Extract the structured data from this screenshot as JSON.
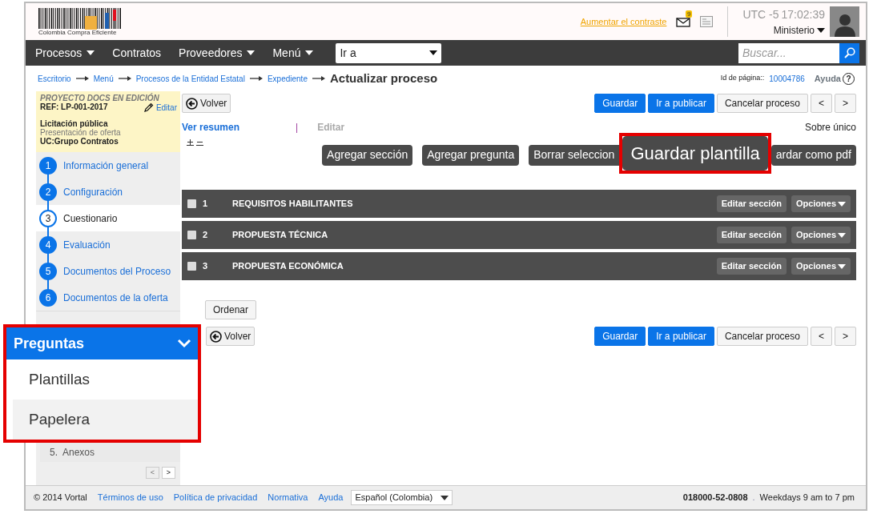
{
  "header": {
    "logo_text": "Colombia Compra Eficiente",
    "contrast_link": "Aumentar el contraste",
    "mail_count": "9",
    "timezone": "UTC -5",
    "time": "17:02:39",
    "user": "Ministerio"
  },
  "nav": {
    "items": [
      {
        "label": "Procesos",
        "dropdown": true
      },
      {
        "label": "Contratos",
        "dropdown": false
      },
      {
        "label": "Proveedores",
        "dropdown": true
      },
      {
        "label": "Menú",
        "dropdown": true
      }
    ],
    "goto": "Ir a",
    "search_placeholder": "Buscar..."
  },
  "breadcrumb": {
    "links": [
      "Escritorio",
      "Menú",
      "Procesos de la Entidad Estatal",
      "Expediente"
    ],
    "current": "Actualizar proceso",
    "page_id_label": "Id de página::",
    "page_id": "10004786",
    "help": "Ayuda",
    "help_mark": "?"
  },
  "sidebar": {
    "status": "PROYECTO DOCS EN EDICIÓN",
    "ref": "REF: LP-001-2017",
    "edit": "Editar",
    "type": "Licitación pública",
    "phase": "Presentación de oferta",
    "unit": "UC:Grupo Contratos",
    "steps": [
      {
        "number": "1",
        "label": "Información general",
        "selected": false
      },
      {
        "number": "2",
        "label": "Configuración",
        "selected": false
      },
      {
        "number": "3",
        "label": "Cuestionario",
        "selected": true
      },
      {
        "number": "4",
        "label": "Evaluación",
        "selected": false
      },
      {
        "number": "5",
        "label": "Documentos del Proceso",
        "selected": false
      },
      {
        "number": "6",
        "label": "Documentos de la oferta",
        "selected": false
      }
    ],
    "outline_number": "5.",
    "outline_item": "Anexos",
    "pager": [
      {
        "label": "<",
        "disabled": true
      },
      {
        "label": ">",
        "disabled": false
      }
    ]
  },
  "top_actions": {
    "back": "Volver",
    "buttons": [
      {
        "label": "Guardar",
        "kind": "primary"
      },
      {
        "label": "Ir a publicar",
        "kind": "primary"
      },
      {
        "label": "Cancelar proceso",
        "kind": "secondary"
      },
      {
        "label": "<",
        "kind": "secondary"
      },
      {
        "label": ">",
        "kind": "secondary"
      }
    ]
  },
  "view_tabs": [
    {
      "label": "Ver resumen",
      "selected": true
    },
    {
      "label": "Editar",
      "selected": false
    }
  ],
  "tab_separator": "|",
  "envelope": "Sobre único",
  "toolbar": [
    {
      "label": "Agregar sección",
      "highlighted": false
    },
    {
      "label": "Agregar pregunta",
      "highlighted": false
    },
    {
      "label": "Borrar seleccion",
      "highlighted": false
    },
    {
      "label": "Guardar plantilla",
      "highlighted": true
    },
    {
      "label": "ardar como pdf",
      "highlighted": false
    }
  ],
  "sections": {
    "rows": [
      {
        "number": "1",
        "title": "REQUISITOS HABILITANTES",
        "checked": false,
        "edit_label": "Editar sección",
        "options_label": "Opciones"
      },
      {
        "number": "2",
        "title": "PROPUESTA TÉCNICA",
        "checked": false,
        "edit_label": "Editar sección",
        "options_label": "Opciones"
      },
      {
        "number": "3",
        "title": "PROPUESTA ECONÓMICA",
        "checked": false,
        "edit_label": "Editar sección",
        "options_label": "Opciones"
      }
    ]
  },
  "order_button": "Ordenar",
  "bottom_actions": {
    "back": "Volver",
    "buttons": [
      {
        "label": "Guardar",
        "kind": "primary"
      },
      {
        "label": "Ir a publicar",
        "kind": "primary"
      },
      {
        "label": "Cancelar proceso",
        "kind": "secondary"
      },
      {
        "label": "<",
        "kind": "secondary"
      },
      {
        "label": ">",
        "kind": "secondary"
      }
    ]
  },
  "questions_panel": {
    "title": "Preguntas",
    "expanded": true,
    "items": [
      {
        "label": "Plantillas",
        "selected": false
      },
      {
        "label": "Papelera",
        "selected": true
      }
    ]
  },
  "footer": {
    "copyright": "© 2014 Vortal",
    "links": [
      "Términos de uso",
      "Política de privacidad",
      "Normativa",
      "Ayuda"
    ],
    "language": "Español (Colombia)",
    "phone": "018000-52-0808",
    "separator": ".",
    "hours": "Weekdays 9 am to 7 pm"
  }
}
